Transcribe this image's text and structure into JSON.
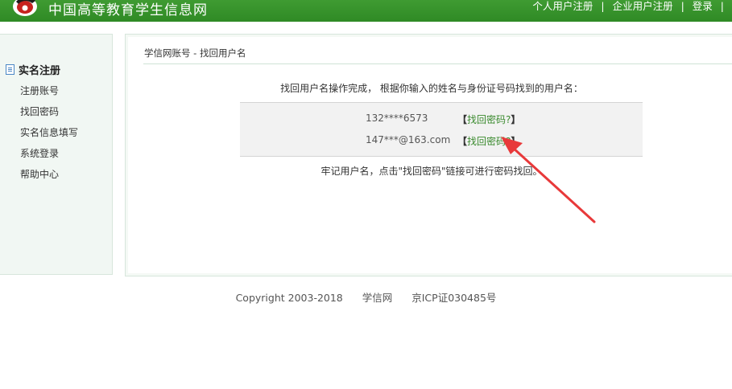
{
  "header": {
    "site_name": "中国高等教育学生信息网",
    "nav": {
      "personal_register": "个人用户注册",
      "enterprise_register": "企业用户注册",
      "login": "登录",
      "separator": "|"
    }
  },
  "sidebar": {
    "title": "实名注册",
    "items": [
      {
        "label": "注册账号"
      },
      {
        "label": "找回密码"
      },
      {
        "label": "实名信息填写"
      },
      {
        "label": "系统登录"
      },
      {
        "label": "帮助中心"
      }
    ]
  },
  "main": {
    "breadcrumb": "学信网账号 - 找回用户名",
    "message": "找回用户名操作完成， 根据你输入的姓名与身份证号码找到的用户名：",
    "results": [
      {
        "username": "132****6573",
        "link": {
          "open": "【",
          "text": "找回密码?",
          "close": "】"
        }
      },
      {
        "username": "147***@163.com",
        "link": {
          "open": "【",
          "text": "找回密码?",
          "close": "】"
        }
      }
    ],
    "note": "牢记用户名，点击\"找回密码\"链接可进行密码找回。"
  },
  "footer": {
    "copyright": "Copyright 2003-2018",
    "site": "学信网",
    "icp": "京ICP证030485号"
  },
  "colors": {
    "header_green": "#3f9b32",
    "link_green": "#3a8a2e",
    "arrow_red": "#e8393a"
  }
}
